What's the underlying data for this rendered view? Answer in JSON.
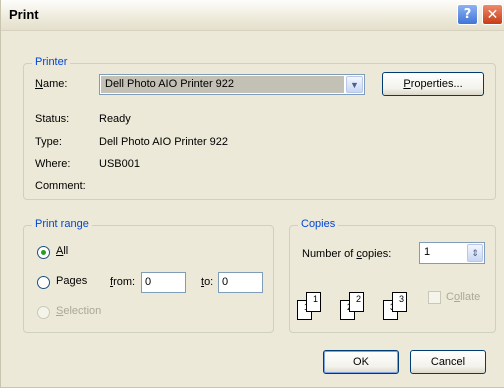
{
  "window": {
    "title": "Print"
  },
  "printer": {
    "legend": "Printer",
    "name_label": "Name:",
    "name_value": "Dell Photo AIO Printer 922",
    "properties_label": "Properties...",
    "status_label": "Status:",
    "status_value": "Ready",
    "type_label": "Type:",
    "type_value": "Dell Photo AIO Printer 922",
    "where_label": "Where:",
    "where_value": "USB001",
    "comment_label": "Comment:",
    "comment_value": ""
  },
  "print_range": {
    "legend": "Print range",
    "all_label": "All",
    "pages_label": "Pages",
    "from_label": "from:",
    "from_value": "0",
    "to_label": "to:",
    "to_value": "0",
    "selection_label": "Selection",
    "selected": "all"
  },
  "copies": {
    "legend": "Copies",
    "number_label": "Number of copies:",
    "number_value": "1",
    "collate_label": "Collate",
    "collate_checked": false,
    "collate_enabled": false,
    "page_numbers": [
      "1",
      "1",
      "2",
      "2",
      "3",
      "3"
    ]
  },
  "buttons": {
    "ok": "OK",
    "cancel": "Cancel"
  },
  "icons": {
    "help": "help-icon",
    "close": "close-icon",
    "dropdown": "chevron-down-icon",
    "spin": "spin-up-down-icon",
    "collate": "collate-pages-icon"
  },
  "colors": {
    "dialog_background": "#ece9d8",
    "group_label": "#0046d5",
    "close_button": "#c83b16",
    "help_button": "#3f74d8"
  }
}
